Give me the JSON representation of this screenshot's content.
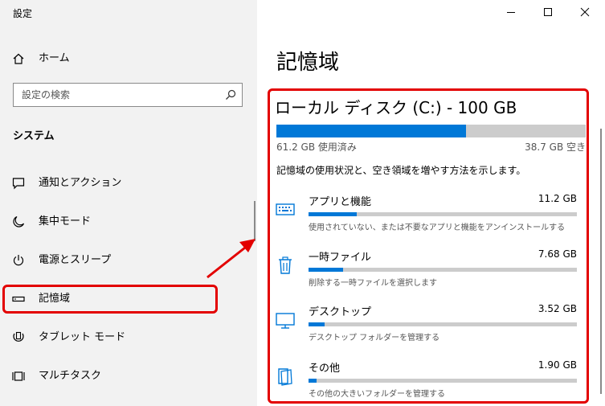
{
  "app": {
    "title": "設定"
  },
  "sidebar": {
    "home": "ホーム",
    "search": {
      "placeholder": "設定の検索"
    },
    "section": "システム",
    "items": [
      {
        "label": "通知とアクション",
        "icon": "notification-icon"
      },
      {
        "label": "集中モード",
        "icon": "moon-icon"
      },
      {
        "label": "電源とスリープ",
        "icon": "power-icon"
      },
      {
        "label": "記憶域",
        "icon": "storage-icon",
        "selected": true
      },
      {
        "label": "タブレット モード",
        "icon": "tablet-icon"
      },
      {
        "label": "マルチタスク",
        "icon": "multitask-icon"
      }
    ]
  },
  "window": {
    "controls": [
      "minimize",
      "maximize",
      "close"
    ]
  },
  "main": {
    "title": "記憶域",
    "drive": {
      "name": "ローカル ディスク (C:) - 100 GB",
      "used_fraction": 0.612,
      "used_label": "61.2 GB 使用済み",
      "free_label": "38.7 GB 空き"
    },
    "description": "記憶域の使用状況と、空き領域を増やす方法を示します。",
    "categories": [
      {
        "name": "アプリと機能",
        "size": "11.2 GB",
        "fraction": 0.18,
        "desc": "使用されていない、または不要なアプリと機能をアンインストールする",
        "icon": "apps-icon"
      },
      {
        "name": "一時ファイル",
        "size": "7.68 GB",
        "fraction": 0.13,
        "desc": "削除する一時ファイルを選択します",
        "icon": "trash-icon"
      },
      {
        "name": "デスクトップ",
        "size": "3.52 GB",
        "fraction": 0.06,
        "desc": "デスクトップ フォルダーを管理する",
        "icon": "desktop-icon"
      },
      {
        "name": "その他",
        "size": "1.90 GB",
        "fraction": 0.03,
        "desc": "その他の大きいフォルダーを管理する",
        "icon": "folder-icon"
      }
    ]
  },
  "colors": {
    "accent": "#0078d7",
    "highlight": "#e30000",
    "sidebar_bg": "#f2f2f2",
    "bar_bg": "#cccccc"
  }
}
